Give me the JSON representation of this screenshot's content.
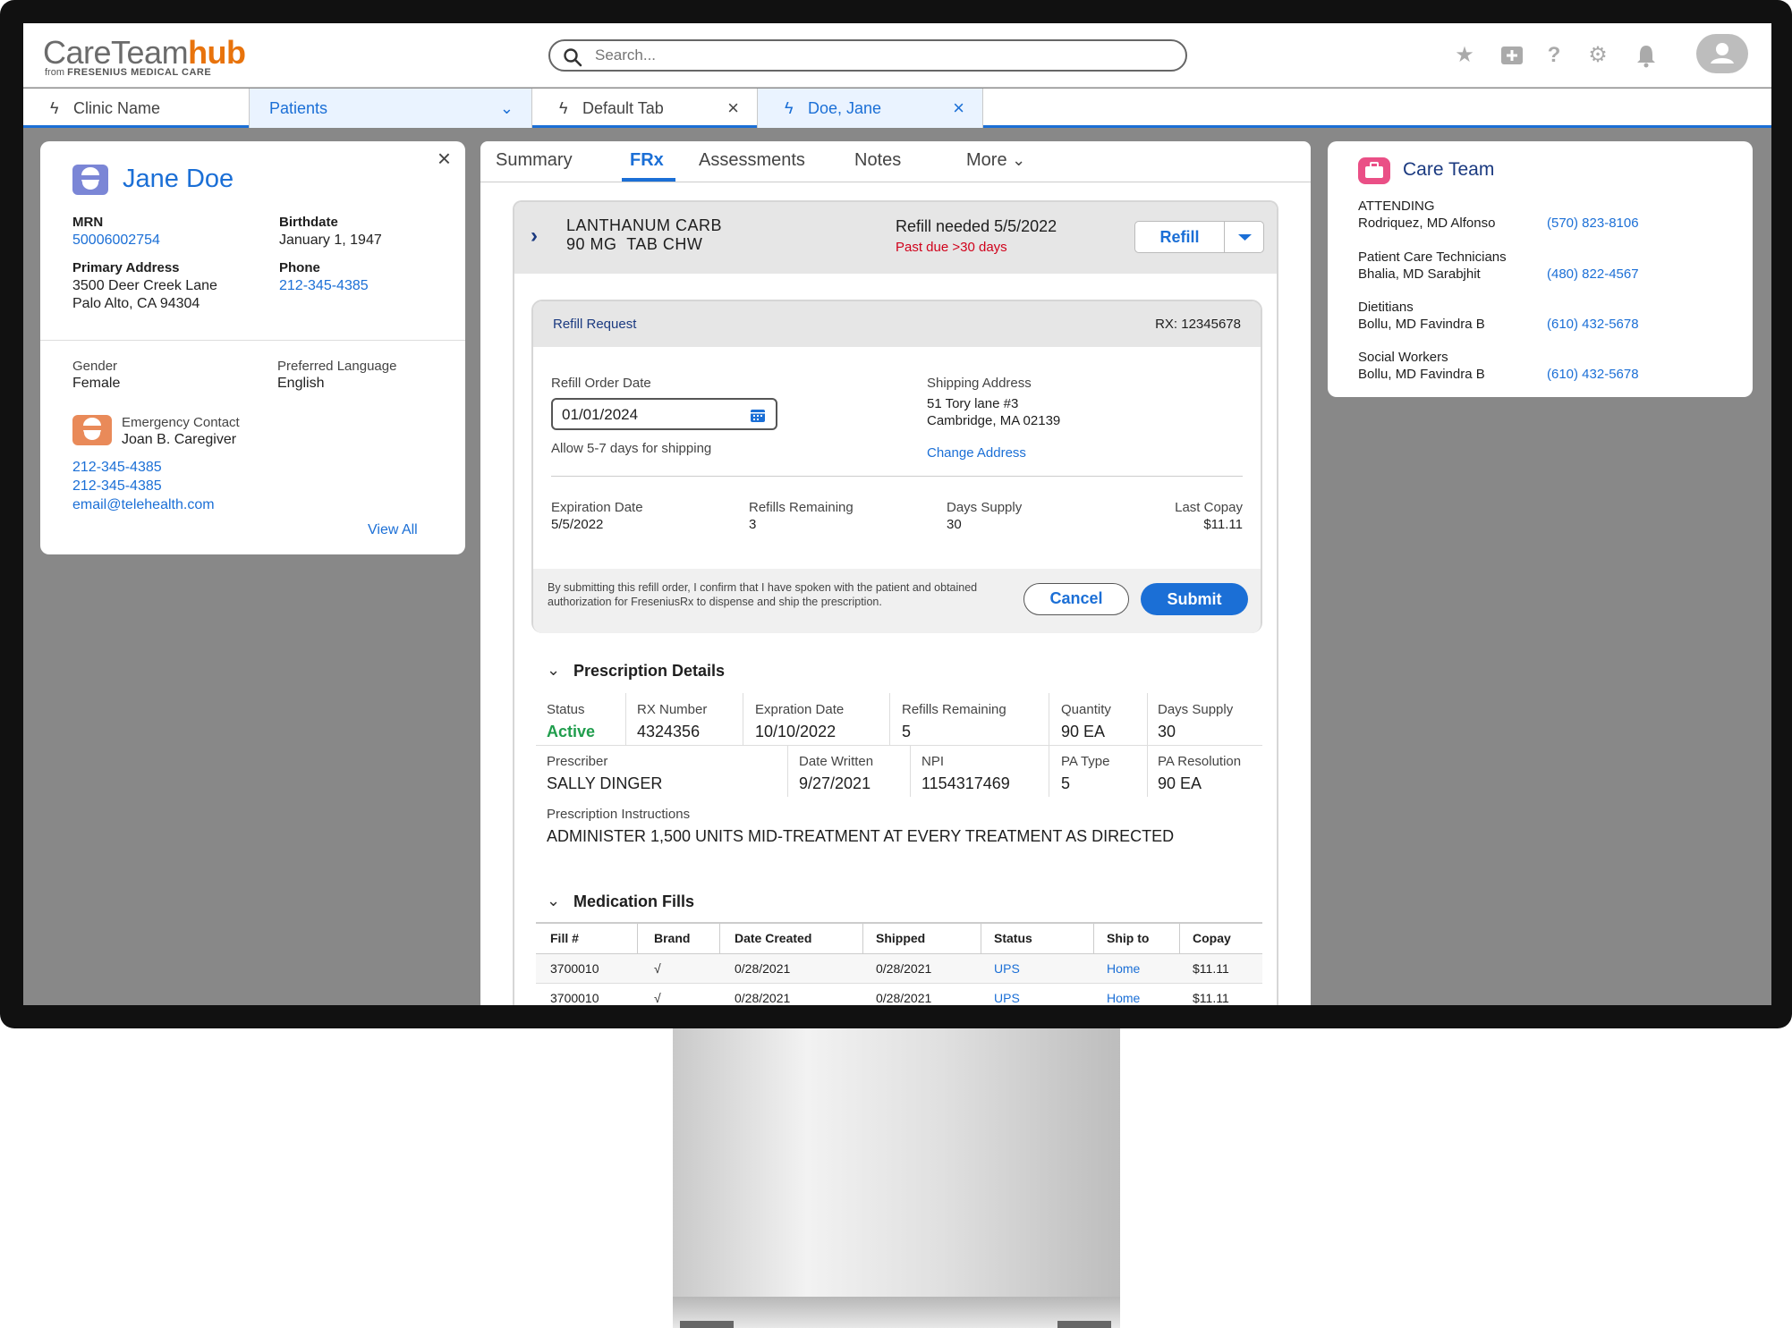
{
  "app": {
    "logo_main": "CareTeam",
    "logo_accent": "hub",
    "logo_sub_prefix": "from",
    "logo_sub_brand": "FRESENIUS MEDICAL CARE",
    "search_placeholder": "Search..."
  },
  "header_icons": [
    "star-icon",
    "add-icon",
    "help-icon",
    "gear-icon",
    "bell-icon",
    "user-avatar-icon"
  ],
  "tabs": [
    {
      "label": "Clinic Name",
      "closable": false
    },
    {
      "label": "Patients",
      "dropdown": true
    },
    {
      "label": "Default Tab",
      "closable": true
    },
    {
      "label": "Doe, Jane",
      "closable": true,
      "active": true
    }
  ],
  "patient": {
    "name": "Jane Doe",
    "mrn_label": "MRN",
    "mrn": "50006002754",
    "birthdate_label": "Birthdate",
    "birthdate": "January 1, 1947",
    "address_label": "Primary Address",
    "address_line1": "3500 Deer Creek Lane",
    "address_line2": "Palo Alto, CA 94304",
    "phone_label": "Phone",
    "phone": "212-345-4385",
    "gender_label": "Gender",
    "gender": "Female",
    "language_label": "Preferred Language",
    "language": "English",
    "emergency_label": "Emergency Contact",
    "emergency_name": "Joan B. Caregiver",
    "emergency_phone1": "212-345-4385",
    "emergency_phone2": "212-345-4385",
    "emergency_email": "email@telehealth.com",
    "view_all": "View All"
  },
  "center_tabs": [
    "Summary",
    "FRx",
    "Assessments",
    "Notes",
    "More"
  ],
  "medication": {
    "name_line1": "LANTHANUM CARB",
    "name_line2": "90 MG  TAB CHW",
    "refill_needed": "Refill needed 5/5/2022",
    "past_due": "Past due >30 days",
    "refill_button": "Refill"
  },
  "refill_request": {
    "title": "Refill Request",
    "rx": "RX: 12345678",
    "order_date_label": "Refill Order Date",
    "order_date": "01/01/2024",
    "shipping_note": "Allow 5-7 days for shipping",
    "shipping_label": "Shipping Address",
    "shipping_line1": "51 Tory lane #3",
    "shipping_line2": "Cambridge, MA 02139",
    "change_address": "Change Address",
    "expiration_label": "Expiration Date",
    "expiration": "5/5/2022",
    "refills_label": "Refills Remaining",
    "refills": "3",
    "days_label": "Days Supply",
    "days": "30",
    "copay_label": "Last Copay",
    "copay": "$11.11",
    "disclaimer": "By submitting this refill order, I confirm that I have spoken with the patient and obtained authorization for FreseniusRx to dispense and ship the prescription.",
    "cancel": "Cancel",
    "submit": "Submit"
  },
  "prescription": {
    "title": "Prescription Details",
    "status_label": "Status",
    "status": "Active",
    "rx_label": "RX Number",
    "rx": "4324356",
    "exp_label": "Expration Date",
    "exp": "10/10/2022",
    "refills_label": "Refills Remaining",
    "refills": "5",
    "qty_label": "Quantity",
    "qty": "90 EA",
    "days_label": "Days Supply",
    "days": "30",
    "prescriber_label": "Prescriber",
    "prescriber": "SALLY DINGER",
    "written_label": "Date Written",
    "written": "9/27/2021",
    "npi_label": "NPI",
    "npi": "1154317469",
    "pa_type_label": "PA Type",
    "pa_type": "5",
    "pa_res_label": "PA Resolution",
    "pa_res": "90 EA",
    "instr_label": "Prescription Instructions",
    "instr": "ADMINISTER 1,500 UNITS MID-TREATMENT AT EVERY TREATMENT AS DIRECTED"
  },
  "fills": {
    "title": "Medication Fills",
    "columns": [
      "Fill #",
      "Brand",
      "Date Created",
      "Shipped",
      "Status",
      "Ship to",
      "Copay"
    ],
    "rows": [
      [
        "3700010",
        "√",
        "0/28/2021",
        "0/28/2021",
        "UPS",
        "Home",
        "$11.11"
      ],
      [
        "3700010",
        "√",
        "0/28/2021",
        "0/28/2021",
        "UPS",
        "Home",
        "$11.11"
      ]
    ]
  },
  "care_team": {
    "title": "Care Team",
    "members": [
      {
        "role": "ATTENDING",
        "name": "Rodriquez, MD Alfonso",
        "phone": "(570) 823-8106"
      },
      {
        "role": "Patient Care Technicians",
        "name": "Bhalia, MD Sarabjhit",
        "phone": "(480) 822-4567"
      },
      {
        "role": "Dietitians",
        "name": "Bollu, MD Favindra B",
        "phone": "(610) 432-5678"
      },
      {
        "role": "Social Workers",
        "name": "Bollu, MD Favindra B",
        "phone": "(610) 432-5678"
      }
    ]
  },
  "colors": {
    "accent": "#1b6fd6",
    "brand_orange": "#e8730c",
    "active_green": "#1f9d4c",
    "alert_red": "#d0021b"
  }
}
